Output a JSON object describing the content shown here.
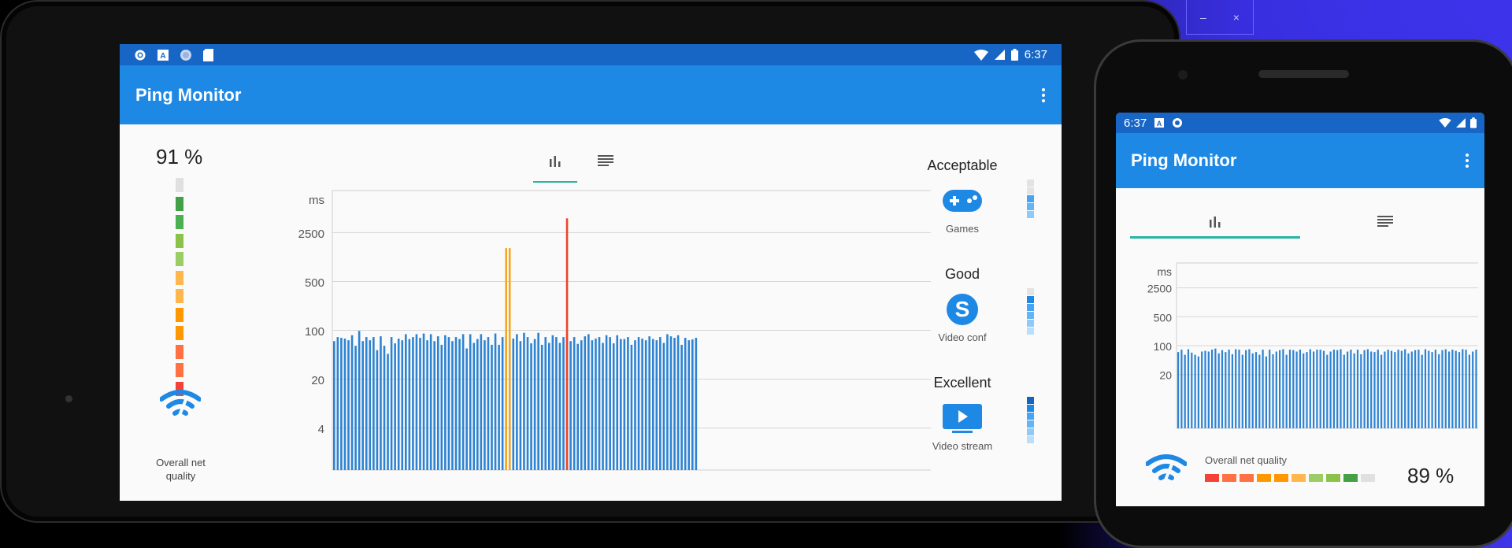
{
  "window_controls": {
    "minimize": "–",
    "close": "×"
  },
  "tablet": {
    "status_time": "6:37",
    "app_title": "Ping Monitor",
    "overall_quality_pct": "91 %",
    "overall_quality_label": "Overall net quality",
    "quality_levels": [
      "#e0e0e0",
      "#43a047",
      "#4caf50",
      "#8bc34a",
      "#9ccc65",
      "#ffb74d",
      "#ffb74d",
      "#ff9800",
      "#ff9800",
      "#ff7043",
      "#ff7043",
      "#f44336"
    ],
    "tabs": [
      {
        "name": "chart",
        "active": true
      },
      {
        "name": "log",
        "active": false
      }
    ],
    "categories": [
      {
        "title": "Acceptable",
        "sub": "Games",
        "icon": "gamepad-icon",
        "levels": [
          0,
          0,
          1,
          1,
          1
        ]
      },
      {
        "title": "Good",
        "sub": "Video conf",
        "icon": "skype-icon",
        "levels": [
          0,
          1,
          1,
          1,
          1,
          1
        ]
      },
      {
        "title": "Excellent",
        "sub": "Video stream",
        "icon": "video-stream-icon",
        "levels": [
          1,
          1,
          1,
          1,
          1,
          1
        ]
      }
    ]
  },
  "phone": {
    "status_time": "6:37",
    "app_title": "Ping Monitor",
    "overall_quality_label": "Overall net quality",
    "overall_quality_pct": "89 %",
    "quality_segments": [
      "#f44336",
      "#ff7043",
      "#ff7043",
      "#ff9800",
      "#ff9800",
      "#ffb74d",
      "#9ccc65",
      "#8bc34a",
      "#43a047",
      "#e0e0e0"
    ]
  },
  "colors": {
    "accent": "#1e88e5",
    "status_bar": "#1766c5",
    "tab_indicator": "#26b5a2",
    "bar": "#2d83d2",
    "spike_orange": "#f5a623",
    "spike_red": "#f0432a"
  },
  "chart_data": [
    {
      "type": "bar",
      "title": "",
      "ylabel": "ms",
      "y_ticks": [
        "2500",
        "500",
        "100",
        "20",
        "4"
      ],
      "scale": "log",
      "series": [
        {
          "values": [
            70,
            80,
            78,
            76,
            72,
            85,
            60,
            98,
            70,
            80,
            72,
            80,
            52,
            82,
            60,
            46,
            80,
            65,
            76,
            72,
            88,
            75,
            80,
            88,
            78,
            90,
            72,
            88,
            70,
            82,
            62,
            85,
            80,
            70,
            80,
            75,
            88,
            55,
            88,
            66,
            75,
            88,
            72,
            80,
            62,
            90,
            62,
            80,
            82,
            66,
            76,
            88,
            70,
            92,
            80,
            65,
            75,
            92,
            62,
            80,
            66,
            85,
            80,
            66,
            80,
            88,
            70,
            80,
            64,
            72,
            82,
            88,
            72,
            76,
            80,
            66,
            85,
            80,
            65,
            85,
            75,
            75,
            80,
            62,
            72,
            80,
            76,
            72,
            82,
            75,
            72,
            80,
            66,
            88,
            82,
            78,
            85,
            62,
            78,
            72,
            74,
            78
          ]
        },
        {
          "name": "",
          "values_spikes": [
            {
              "index": 48,
              "value": 1500
            },
            {
              "index": 49,
              "value": 1500
            },
            {
              "index": 65,
              "value": 4000
            }
          ]
        }
      ]
    },
    {
      "type": "bar",
      "title": "",
      "ylabel": "ms",
      "y_ticks": [
        "2500",
        "500",
        "100",
        "20"
      ],
      "scale": "log",
      "series": [
        {
          "values": [
            70,
            80,
            60,
            82,
            68,
            60,
            55,
            72,
            75,
            72,
            80,
            85,
            65,
            78,
            70,
            80,
            62,
            82,
            80,
            60,
            78,
            82,
            65,
            70,
            60,
            80,
            55,
            80,
            62,
            72,
            78,
            82,
            60,
            80,
            78,
            72,
            80,
            65,
            70,
            82,
            72,
            80,
            80,
            75,
            60,
            72,
            80,
            78,
            82,
            60,
            72,
            80,
            65,
            80,
            62,
            78,
            82,
            72,
            70,
            80,
            60,
            72,
            80,
            75,
            70,
            80,
            75,
            82,
            65,
            72,
            78,
            80,
            60,
            82,
            75,
            70,
            80,
            62,
            78,
            82,
            72,
            80,
            75,
            70,
            82,
            80,
            60,
            72,
            80,
            85
          ]
        }
      ]
    }
  ]
}
